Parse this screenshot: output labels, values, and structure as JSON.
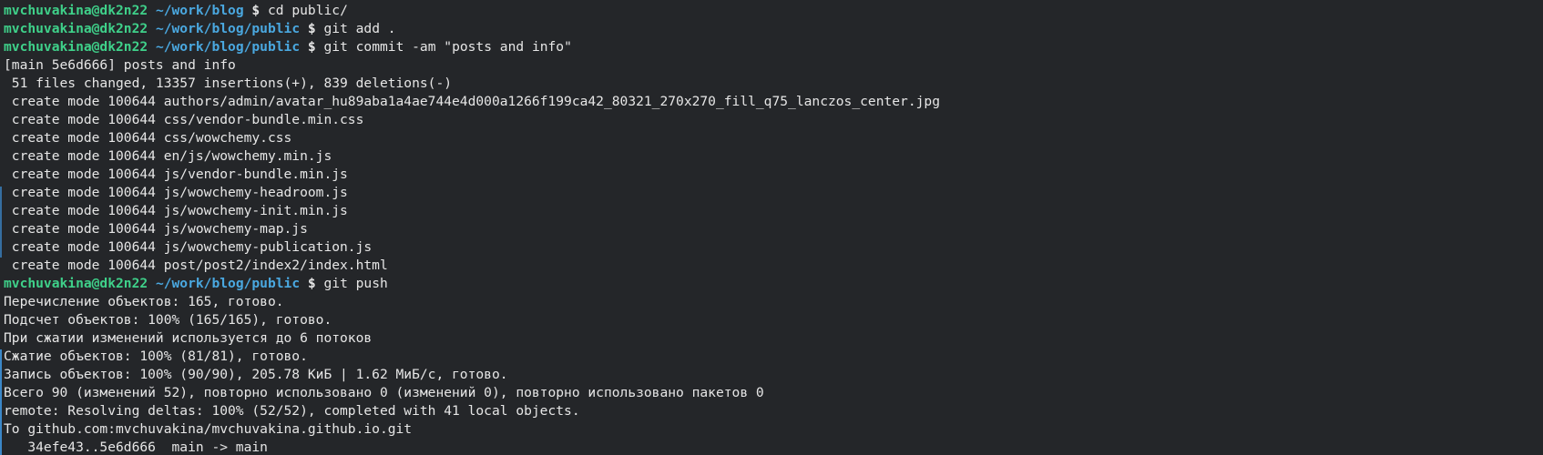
{
  "prompt": {
    "user_host": "mvchuvakina@dk2n22",
    "symbol": "$"
  },
  "lines": [
    {
      "type": "prompt",
      "path": "~/work/blog",
      "command": "cd public/"
    },
    {
      "type": "prompt",
      "path": "~/work/blog/public",
      "command": "git add ."
    },
    {
      "type": "prompt",
      "path": "~/work/blog/public",
      "command": "git commit -am \"posts and info\""
    },
    {
      "type": "output",
      "text": "[main 5e6d666] posts and info"
    },
    {
      "type": "output",
      "text": " 51 files changed, 13357 insertions(+), 839 deletions(-)"
    },
    {
      "type": "output",
      "text": " create mode 100644 authors/admin/avatar_hu89aba1a4ae744e4d000a1266f199ca42_80321_270x270_fill_q75_lanczos_center.jpg"
    },
    {
      "type": "output",
      "text": " create mode 100644 css/vendor-bundle.min.css"
    },
    {
      "type": "output",
      "text": " create mode 100644 css/wowchemy.css"
    },
    {
      "type": "output",
      "text": " create mode 100644 en/js/wowchemy.min.js"
    },
    {
      "type": "output",
      "text": " create mode 100644 js/vendor-bundle.min.js"
    },
    {
      "type": "output",
      "text": " create mode 100644 js/wowchemy-headroom.js"
    },
    {
      "type": "output",
      "text": " create mode 100644 js/wowchemy-init.min.js"
    },
    {
      "type": "output",
      "text": " create mode 100644 js/wowchemy-map.js"
    },
    {
      "type": "output",
      "text": " create mode 100644 js/wowchemy-publication.js"
    },
    {
      "type": "output",
      "text": " create mode 100644 post/post2/index2/index.html"
    },
    {
      "type": "prompt",
      "path": "~/work/blog/public",
      "command": "git push"
    },
    {
      "type": "output",
      "text": "Перечисление объектов: 165, готово."
    },
    {
      "type": "output",
      "text": "Подсчет объектов: 100% (165/165), готово."
    },
    {
      "type": "output",
      "text": "При сжатии изменений используется до 6 потоков"
    },
    {
      "type": "output",
      "text": "Сжатие объектов: 100% (81/81), готово."
    },
    {
      "type": "output",
      "text": "Запись объектов: 100% (90/90), 205.78 КиБ | 1.62 МиБ/с, готово."
    },
    {
      "type": "output",
      "text": "Всего 90 (изменений 52), повторно использовано 0 (изменений 0), повторно использовано пакетов 0"
    },
    {
      "type": "output",
      "text": "remote: Resolving deltas: 100% (52/52), completed with 41 local objects."
    },
    {
      "type": "output",
      "text": "To github.com:mvchuvakina/mvchuvakina.github.io.git"
    },
    {
      "type": "output",
      "text": "   34efe43..5e6d666  main -> main"
    }
  ]
}
